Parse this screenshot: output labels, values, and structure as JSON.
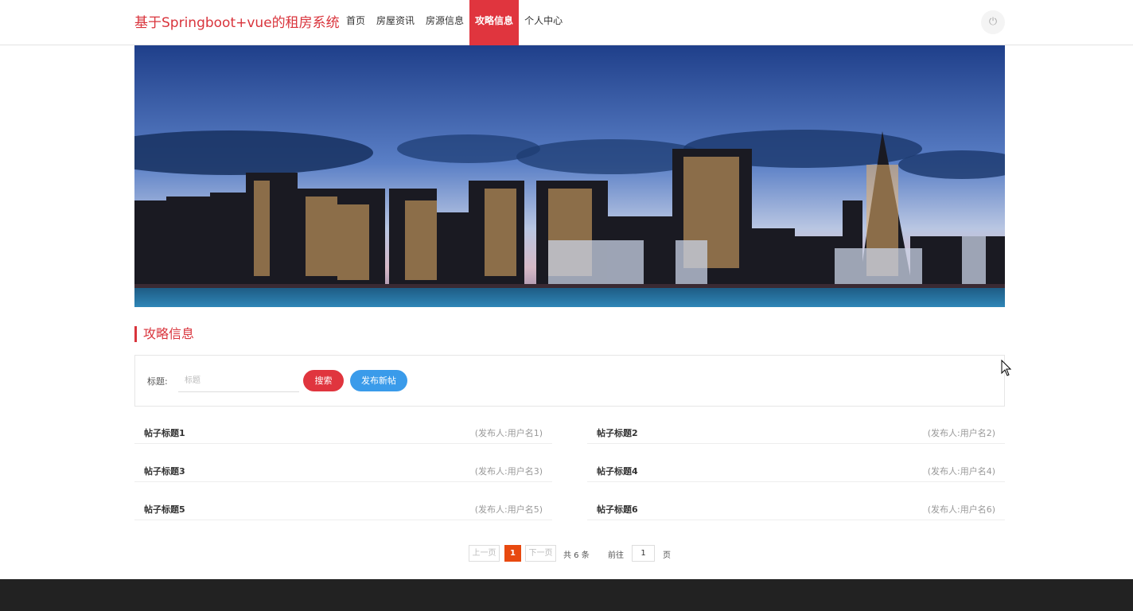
{
  "header": {
    "brand": "基于Springboot+vue的租房系统",
    "nav": [
      {
        "label": "首页",
        "active": false
      },
      {
        "label": "房屋资讯",
        "active": false
      },
      {
        "label": "房源信息",
        "active": false
      },
      {
        "label": "攻略信息",
        "active": true
      },
      {
        "label": "个人中心",
        "active": false
      }
    ],
    "power_icon": "power-icon",
    "power_glyph": "⏻"
  },
  "section": {
    "title": "攻略信息"
  },
  "search": {
    "label": "标题:",
    "placeholder": "标题",
    "search_button": "搜索",
    "post_button": "发布新帖"
  },
  "posts": [
    {
      "title": "帖子标题1",
      "author": "(发布人:用户名1)"
    },
    {
      "title": "帖子标题2",
      "author": "(发布人:用户名2)"
    },
    {
      "title": "帖子标题3",
      "author": "(发布人:用户名3)"
    },
    {
      "title": "帖子标题4",
      "author": "(发布人:用户名4)"
    },
    {
      "title": "帖子标题5",
      "author": "(发布人:用户名5)"
    },
    {
      "title": "帖子标题6",
      "author": "(发布人:用户名6)"
    }
  ],
  "pagination": {
    "prev": "上一页",
    "current": "1",
    "next": "下一页",
    "total": "共 6 条",
    "goto": "前往",
    "goto_value": "1",
    "page_unit": "页"
  },
  "colors": {
    "accent": "#e0353e",
    "secondary": "#3a9bea",
    "page_active": "#e8490f",
    "footer": "#222222"
  }
}
